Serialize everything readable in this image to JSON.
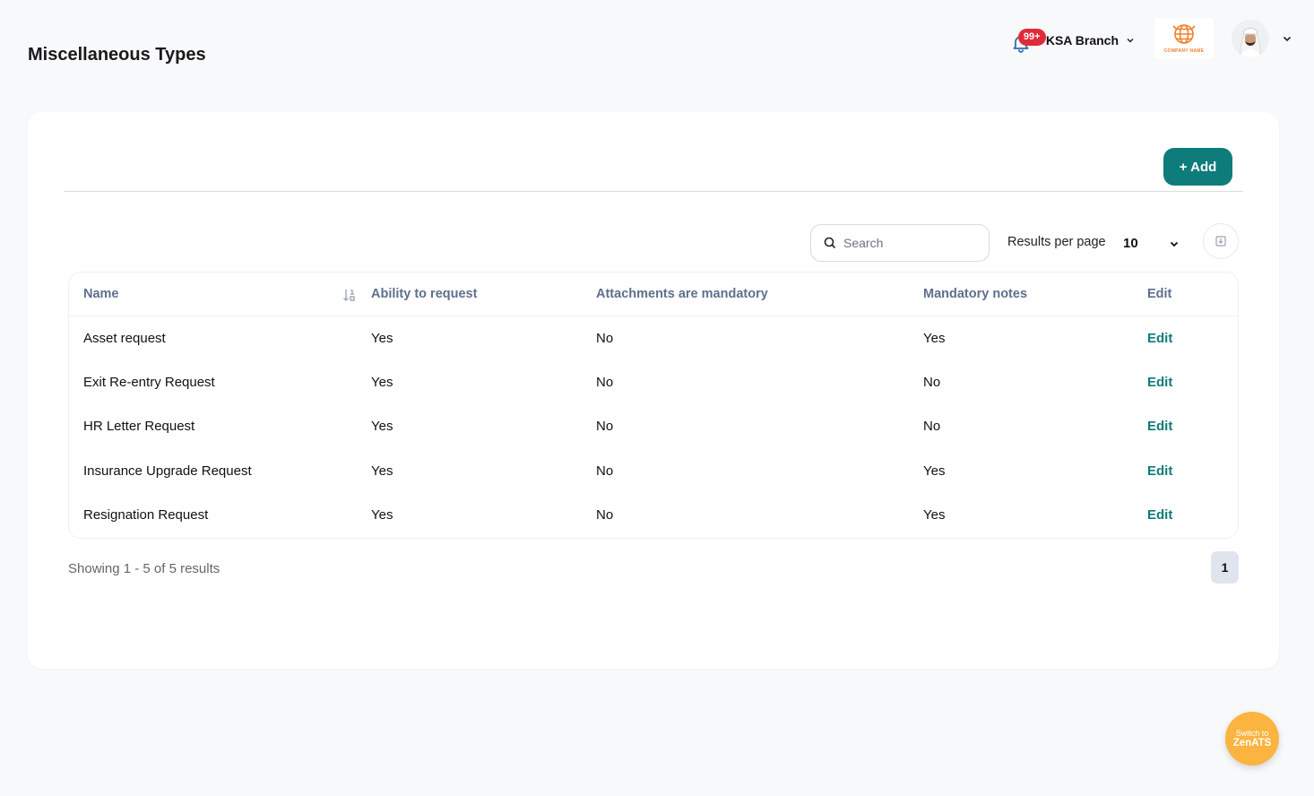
{
  "page": {
    "title": "Miscellaneous Types"
  },
  "topbar": {
    "notification_count": "99+",
    "branch": "KSA Branch",
    "company_logo_text": "COMPANY NAME"
  },
  "toolbar": {
    "add_label": "+ Add",
    "search_placeholder": "Search",
    "results_per_page_label": "Results per page",
    "results_per_page_value": "10"
  },
  "table": {
    "headers": [
      "Name",
      "Ability to request",
      "Attachments are mandatory",
      "Mandatory notes",
      "Edit"
    ],
    "rows": [
      {
        "name": "Asset request",
        "ability": "Yes",
        "attachments": "No",
        "notes": "Yes",
        "edit": "Edit"
      },
      {
        "name": "Exit Re-entry Request",
        "ability": "Yes",
        "attachments": "No",
        "notes": "No",
        "edit": "Edit"
      },
      {
        "name": "HR Letter Request",
        "ability": "Yes",
        "attachments": "No",
        "notes": "No",
        "edit": "Edit"
      },
      {
        "name": "Insurance Upgrade Request",
        "ability": "Yes",
        "attachments": "No",
        "notes": "Yes",
        "edit": "Edit"
      },
      {
        "name": "Resignation Request",
        "ability": "Yes",
        "attachments": "No",
        "notes": "Yes",
        "edit": "Edit"
      }
    ]
  },
  "footer": {
    "showing": "Showing 1 - 5 of 5 results",
    "current_page": "1"
  },
  "fab": {
    "line1": "Switch to",
    "line2": "ZenATS"
  },
  "colors": {
    "accent": "#0e7c7b",
    "badge": "#e02a3a",
    "fab": "#fbb440"
  }
}
